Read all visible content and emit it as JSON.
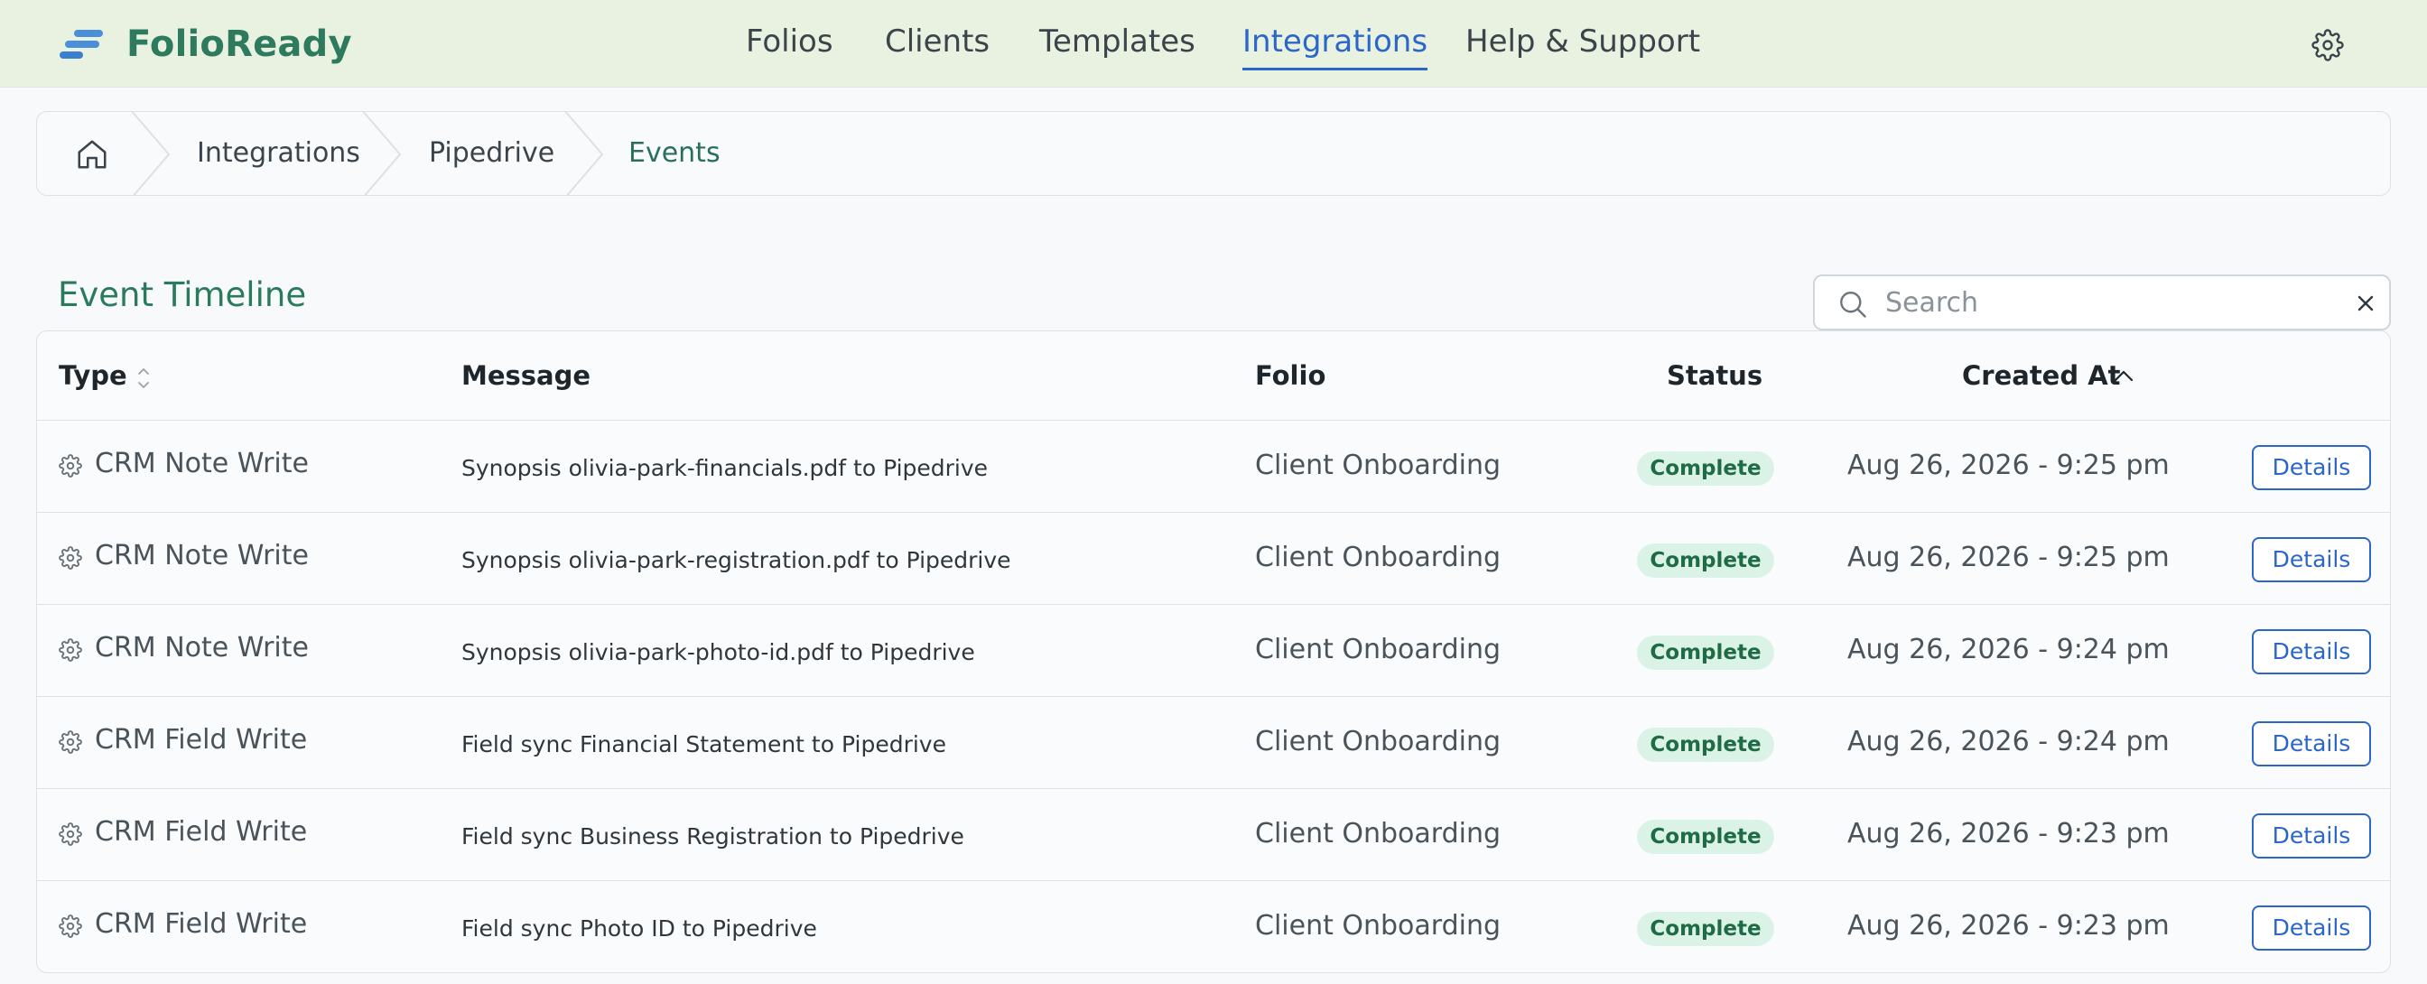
{
  "app": {
    "name": "FolioReady"
  },
  "nav": {
    "items": [
      {
        "label": "Folios",
        "active": false
      },
      {
        "label": "Clients",
        "active": false
      },
      {
        "label": "Templates",
        "active": false
      },
      {
        "label": "Integrations",
        "active": true
      },
      {
        "label": "Help & Support",
        "active": false
      }
    ],
    "settings_icon": "gear-icon"
  },
  "breadcrumb": {
    "home_icon": "home-icon",
    "items": [
      "Integrations",
      "Pipedrive",
      "Events"
    ]
  },
  "timeline": {
    "title": "Event Timeline",
    "search": {
      "placeholder": "Search",
      "value": ""
    },
    "columns": {
      "type": "Type",
      "message": "Message",
      "folio": "Folio",
      "status": "Status",
      "created_at": "Created At"
    },
    "sort": {
      "column": "created_at",
      "direction": "ascending-indicator"
    },
    "rows": [
      {
        "type": "CRM Note Write",
        "message": "Synopsis olivia-park-financials.pdf to Pipedrive",
        "folio": "Client Onboarding",
        "status": "Complete",
        "created_at": "Aug 26, 2026 - 9:25 pm",
        "action": "Details"
      },
      {
        "type": "CRM Note Write",
        "message": "Synopsis olivia-park-registration.pdf to Pipedrive",
        "folio": "Client Onboarding",
        "status": "Complete",
        "created_at": "Aug 26, 2026 - 9:25 pm",
        "action": "Details"
      },
      {
        "type": "CRM Note Write",
        "message": "Synopsis olivia-park-photo-id.pdf to Pipedrive",
        "folio": "Client Onboarding",
        "status": "Complete",
        "created_at": "Aug 26, 2026 - 9:24 pm",
        "action": "Details"
      },
      {
        "type": "CRM Field Write",
        "message": "Field sync Financial Statement to Pipedrive",
        "folio": "Client Onboarding",
        "status": "Complete",
        "created_at": "Aug 26, 2026 - 9:24 pm",
        "action": "Details"
      },
      {
        "type": "CRM Field Write",
        "message": "Field sync Business Registration to Pipedrive",
        "folio": "Client Onboarding",
        "status": "Complete",
        "created_at": "Aug 26, 2026 - 9:23 pm",
        "action": "Details"
      },
      {
        "type": "CRM Field Write",
        "message": "Field sync Photo ID to Pipedrive",
        "folio": "Client Onboarding",
        "status": "Complete",
        "created_at": "Aug 26, 2026 - 9:23 pm",
        "action": "Details"
      }
    ]
  },
  "colors": {
    "accent": "#2b66c9",
    "brand": "#2e7a5e",
    "header_bg": "#e9f2e0",
    "status_complete_bg": "#dbf3e6",
    "status_complete_text": "#1f6b45"
  }
}
